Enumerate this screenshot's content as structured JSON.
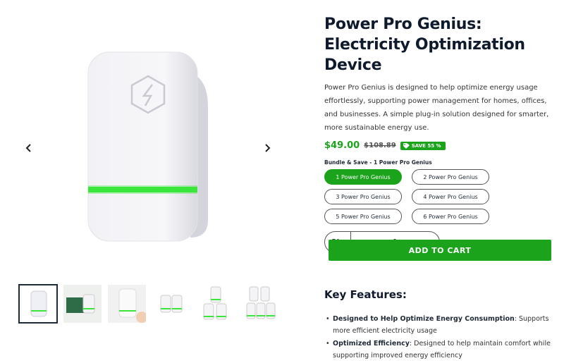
{
  "product": {
    "title": "Power Pro Genius: Electricity Optimization Device",
    "description": "Power Pro Genius is designed to help optimize energy usage effortlessly, supporting power management for homes, offices, and businesses. A simple plug-in solution designed for smarter, more sustainable energy use.",
    "price": "$49.00",
    "compare_price": "$108.89",
    "save_badge": "SAVE 55 %"
  },
  "bundle": {
    "label": "Bundle & Save - 1 Power Pro Genius",
    "options": [
      "1 Power Pro Genius",
      "2 Power Pro Genius",
      "3 Power Pro Genius",
      "4 Power Pro Genius",
      "5 Power Pro Genius",
      "6 Power Pro Genius"
    ],
    "selected_index": 0
  },
  "quantity": {
    "label": "Qty",
    "minus": "-",
    "value": "1",
    "plus": "+"
  },
  "cart": {
    "add_label": "ADD TO CART"
  },
  "features": {
    "title": "Key Features:",
    "items": [
      {
        "bold": "Designed to Help Optimize Energy Consumption",
        "text": ": Supports more efficient electricity usage"
      },
      {
        "bold": "Optimized Efficiency",
        "text": ": Designed to help maintain comfort while supporting improved energy efficiency"
      }
    ]
  },
  "gallery": {
    "thumbnail_count": 6,
    "active_thumbnail": 0
  },
  "colors": {
    "accent": "#1ba31b",
    "device_light": "#39e639",
    "text_dark": "#0f1b2d"
  }
}
